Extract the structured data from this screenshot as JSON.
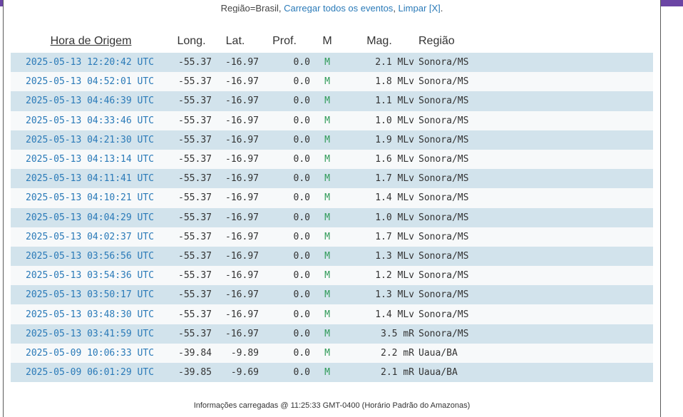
{
  "filter": {
    "prefix": "Região=Brasil, ",
    "load_all": "Carregar todos os eventos",
    "sep": ", ",
    "clear": "Limpar [X]",
    "suffix": "."
  },
  "table": {
    "headers": {
      "time": "Hora de Origem",
      "lon": "Long.",
      "lat": "Lat.",
      "depth": "Prof.",
      "m": "M",
      "mag": "Mag.",
      "region": "Região"
    },
    "rows": [
      {
        "time": "2025-05-13 12:20:42 UTC",
        "lon": "-55.37",
        "lat": "-16.97",
        "depth": "0.0",
        "m": "M",
        "mag": "2.1 MLv",
        "region": "Sonora/MS"
      },
      {
        "time": "2025-05-13 04:52:01 UTC",
        "lon": "-55.37",
        "lat": "-16.97",
        "depth": "0.0",
        "m": "M",
        "mag": "1.8 MLv",
        "region": "Sonora/MS"
      },
      {
        "time": "2025-05-13 04:46:39 UTC",
        "lon": "-55.37",
        "lat": "-16.97",
        "depth": "0.0",
        "m": "M",
        "mag": "1.1 MLv",
        "region": "Sonora/MS"
      },
      {
        "time": "2025-05-13 04:33:46 UTC",
        "lon": "-55.37",
        "lat": "-16.97",
        "depth": "0.0",
        "m": "M",
        "mag": "1.0 MLv",
        "region": "Sonora/MS"
      },
      {
        "time": "2025-05-13 04:21:30 UTC",
        "lon": "-55.37",
        "lat": "-16.97",
        "depth": "0.0",
        "m": "M",
        "mag": "1.9 MLv",
        "region": "Sonora/MS"
      },
      {
        "time": "2025-05-13 04:13:14 UTC",
        "lon": "-55.37",
        "lat": "-16.97",
        "depth": "0.0",
        "m": "M",
        "mag": "1.6 MLv",
        "region": "Sonora/MS"
      },
      {
        "time": "2025-05-13 04:11:41 UTC",
        "lon": "-55.37",
        "lat": "-16.97",
        "depth": "0.0",
        "m": "M",
        "mag": "1.7 MLv",
        "region": "Sonora/MS"
      },
      {
        "time": "2025-05-13 04:10:21 UTC",
        "lon": "-55.37",
        "lat": "-16.97",
        "depth": "0.0",
        "m": "M",
        "mag": "1.4 MLv",
        "region": "Sonora/MS"
      },
      {
        "time": "2025-05-13 04:04:29 UTC",
        "lon": "-55.37",
        "lat": "-16.97",
        "depth": "0.0",
        "m": "M",
        "mag": "1.0 MLv",
        "region": "Sonora/MS"
      },
      {
        "time": "2025-05-13 04:02:37 UTC",
        "lon": "-55.37",
        "lat": "-16.97",
        "depth": "0.0",
        "m": "M",
        "mag": "1.7 MLv",
        "region": "Sonora/MS"
      },
      {
        "time": "2025-05-13 03:56:56 UTC",
        "lon": "-55.37",
        "lat": "-16.97",
        "depth": "0.0",
        "m": "M",
        "mag": "1.3 MLv",
        "region": "Sonora/MS"
      },
      {
        "time": "2025-05-13 03:54:36 UTC",
        "lon": "-55.37",
        "lat": "-16.97",
        "depth": "0.0",
        "m": "M",
        "mag": "1.2 MLv",
        "region": "Sonora/MS"
      },
      {
        "time": "2025-05-13 03:50:17 UTC",
        "lon": "-55.37",
        "lat": "-16.97",
        "depth": "0.0",
        "m": "M",
        "mag": "1.3 MLv",
        "region": "Sonora/MS"
      },
      {
        "time": "2025-05-13 03:48:30 UTC",
        "lon": "-55.37",
        "lat": "-16.97",
        "depth": "0.0",
        "m": "M",
        "mag": "1.4 MLv",
        "region": "Sonora/MS"
      },
      {
        "time": "2025-05-13 03:41:59 UTC",
        "lon": "-55.37",
        "lat": "-16.97",
        "depth": "0.0",
        "m": "M",
        "mag": "3.5 mR",
        "region": "Sonora/MS"
      },
      {
        "time": "2025-05-09 10:06:33 UTC",
        "lon": "-39.84",
        "lat": "-9.89",
        "depth": "0.0",
        "m": "M",
        "mag": "2.2 mR",
        "region": "Uaua/BA"
      },
      {
        "time": "2025-05-09 06:01:29 UTC",
        "lon": "-39.85",
        "lat": "-9.69",
        "depth": "0.0",
        "m": "M",
        "mag": "2.1 mR",
        "region": "Uaua/BA"
      }
    ]
  },
  "footer": "Informações carregadas @ 11:25:33 GMT-0400 (Horário Padrão do Amazonas)",
  "colors": {
    "topbar": "#6b45a4",
    "row_alt": "#d2e3ec",
    "link": "#2a7ab8",
    "mode_manual": "#2e9a57"
  }
}
